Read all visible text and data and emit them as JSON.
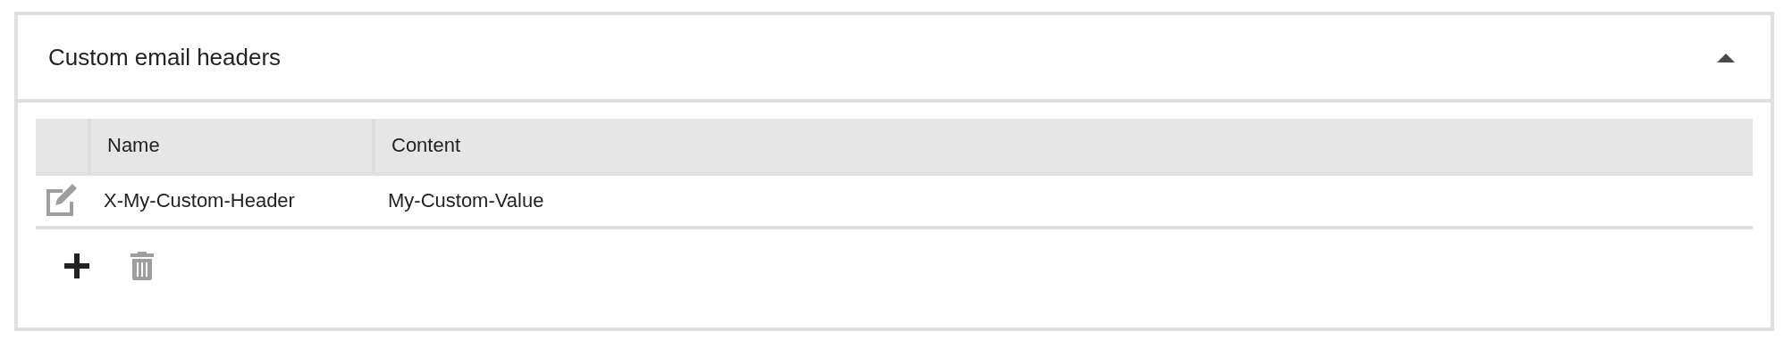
{
  "panel": {
    "title": "Custom email headers",
    "expanded": true
  },
  "table": {
    "columns": [
      "Name",
      "Content"
    ],
    "rows": [
      {
        "cells": [
          "X-My-Custom-Header",
          "My-Custom-Value"
        ]
      }
    ]
  }
}
